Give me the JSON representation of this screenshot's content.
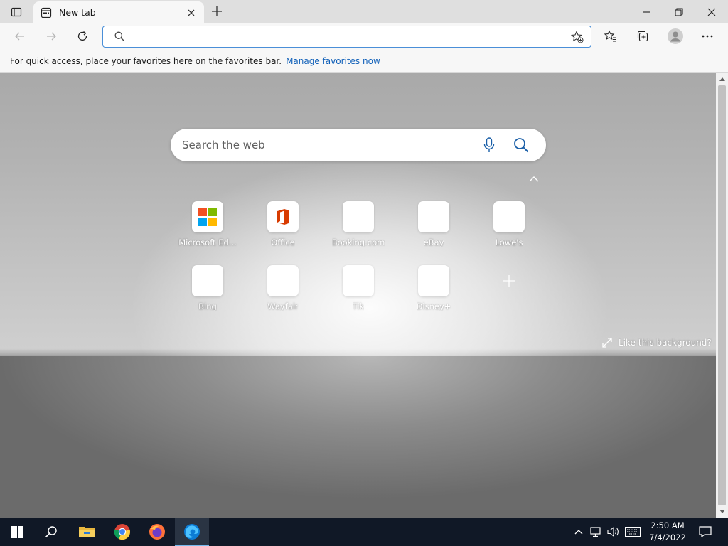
{
  "browser": {
    "tab": {
      "title": "New tab",
      "favicon": "new-tab-icon"
    },
    "window_controls": [
      "minimize",
      "restore",
      "close"
    ]
  },
  "toolbar": {
    "address_value": "",
    "address_placeholder": ""
  },
  "favorites_bar": {
    "message": "For quick access, place your favorites here on the favorites bar.",
    "link": "Manage favorites now"
  },
  "newtab": {
    "search_placeholder": "Search the web",
    "tiles": [
      {
        "label": "Microsoft Ed...",
        "icon": "microsoft-logo"
      },
      {
        "label": "Office",
        "icon": "office-logo"
      },
      {
        "label": "Booking.com",
        "icon": "blank"
      },
      {
        "label": "eBay",
        "icon": "blank"
      },
      {
        "label": "Lowe's",
        "icon": "blank"
      },
      {
        "label": "Bing",
        "icon": "blank"
      },
      {
        "label": "Wayfair",
        "icon": "blank"
      },
      {
        "label": "Tik",
        "icon": "blank"
      },
      {
        "label": "Disney+",
        "icon": "blank"
      }
    ],
    "like_background": "Like this background?"
  },
  "taskbar": {
    "time": "2:50 AM",
    "date": "7/4/2022",
    "apps": [
      "file-explorer",
      "chrome",
      "firefox",
      "edge"
    ]
  },
  "colors": {
    "accent": "#4a8fd8",
    "link": "#0f5fb8",
    "taskbar": "#101826"
  }
}
